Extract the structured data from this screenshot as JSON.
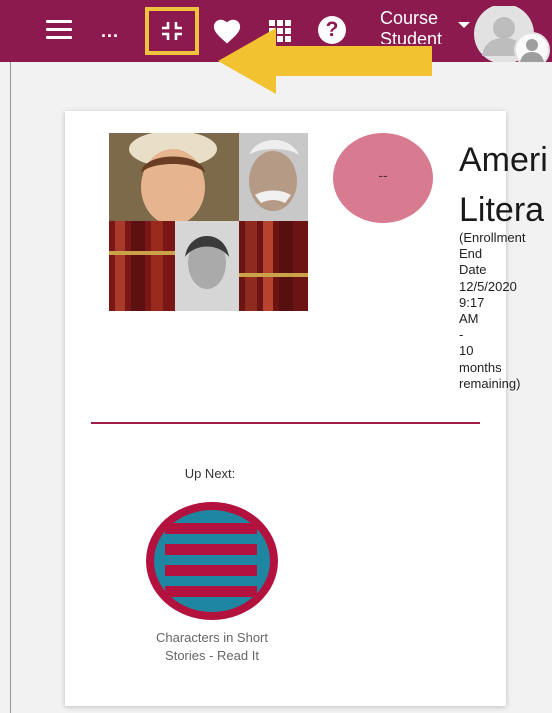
{
  "header": {
    "more_label": "...",
    "help_label": "?",
    "course_label": "Course",
    "role_label": "Student"
  },
  "course": {
    "badge_text": "--",
    "title_lines": [
      "Ameri",
      "Litera"
    ],
    "enrollment_lines": [
      "(Enrollment",
      "End",
      "Date",
      "12/5/2020",
      "9:17",
      "AM",
      "-",
      "10",
      "months",
      "remaining)"
    ]
  },
  "up_next": {
    "heading": "Up Next:",
    "lesson_lines": [
      "Characters in Short",
      "Stories - Read It"
    ]
  },
  "colors": {
    "header_bg": "#8c1a4f",
    "highlight": "#f0c33c",
    "divider": "#a01d45",
    "badge": "#d87a90",
    "lesson_icon_ring": "#b3123f",
    "lesson_icon_fill": "#1f86a1"
  }
}
